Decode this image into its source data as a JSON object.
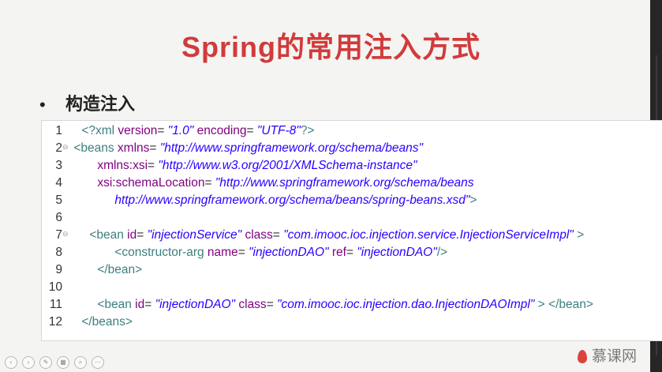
{
  "slide": {
    "title": "Spring的常用注入方式",
    "bullet_marker": "•",
    "bullet": "构造注入"
  },
  "code": {
    "fold_marker": "⊖",
    "lines": [
      {
        "n": "1",
        "p": [
          "<?xml ",
          "version",
          "= ",
          "\"1.0\"",
          " encoding",
          "= ",
          "\"UTF-8\"",
          "?>"
        ]
      },
      {
        "n": "2",
        "p": [
          "<beans ",
          "xmlns",
          "= ",
          "\"http://www.springframework.org/schema/beans\""
        ]
      },
      {
        "n": "3",
        "p": [
          "xmlns:xsi",
          "= ",
          "\"http://www.w3.org/2001/XMLSchema-instance\""
        ]
      },
      {
        "n": "4",
        "p": [
          "xsi:schemaLocation",
          "= ",
          "\"http://www.springframework.org/schema/beans"
        ]
      },
      {
        "n": "5",
        "p": [
          "http://www.springframework.org/schema/beans/spring-beans.xsd\"",
          ">"
        ]
      },
      {
        "n": "6",
        "p": []
      },
      {
        "n": "7",
        "p": [
          "<bean ",
          "id",
          "= ",
          "\"injectionService\"",
          " class",
          "= ",
          "\"com.imooc.ioc.injection.service.InjectionServiceImpl\"",
          " >"
        ]
      },
      {
        "n": "8",
        "p": [
          "<constructor-arg ",
          "name",
          "= ",
          "\"injectionDAO\"",
          " ref",
          "= ",
          "\"injectionDAO\"",
          "/>"
        ]
      },
      {
        "n": "9",
        "p": [
          "</bean>"
        ]
      },
      {
        "n": "10",
        "p": []
      },
      {
        "n": "11",
        "p": [
          "<bean ",
          "id",
          "= ",
          "\"injectionDAO\"",
          " class",
          "= ",
          "\"com.imooc.ioc.injection.dao.InjectionDAOImpl\"",
          " > </bean>"
        ]
      },
      {
        "n": "12",
        "p": [
          "</beans>"
        ]
      }
    ]
  },
  "toolbar": {
    "icons": [
      "prev-icon",
      "next-icon",
      "pen-icon",
      "slides-icon",
      "zoom-icon",
      "more-icon"
    ],
    "glyphs": [
      "‹",
      "›",
      "✎",
      "▦",
      "⌕",
      "⋯"
    ]
  },
  "brand": {
    "logo_text": "慕课网"
  },
  "colors": {
    "title": "#d13b3b",
    "tag": "#3d7f7f",
    "attr": "#7f007f",
    "value": "#2a00ff"
  }
}
